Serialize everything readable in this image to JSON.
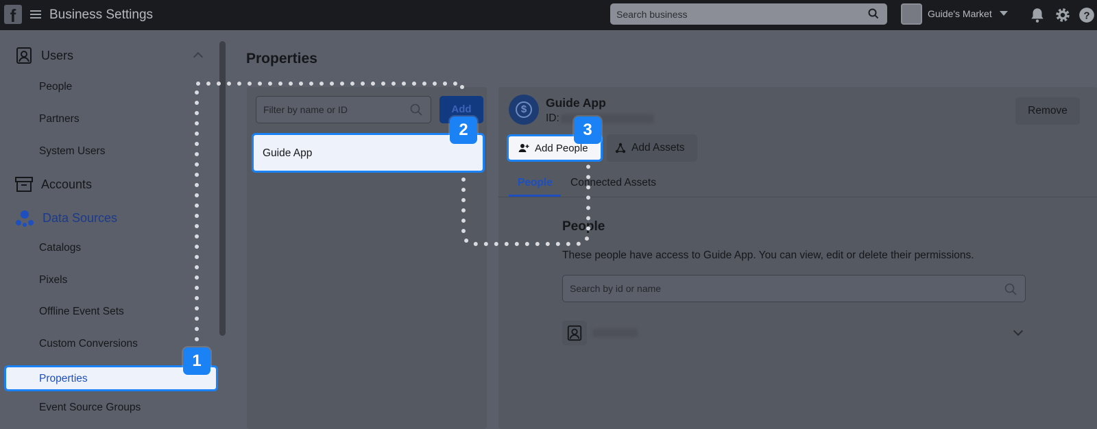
{
  "topbar": {
    "app_title": "Business Settings",
    "search_placeholder": "Search business",
    "business_name": "Guide's Market"
  },
  "sidebar": {
    "sections": {
      "users": "Users",
      "accounts": "Accounts",
      "data_sources": "Data Sources"
    },
    "user_items": [
      "People",
      "Partners",
      "System Users"
    ],
    "data_source_items": [
      "Catalogs",
      "Pixels",
      "Offline Event Sets",
      "Custom Conversions",
      "Properties",
      "Event Source Groups"
    ],
    "active_item": "Properties"
  },
  "main": {
    "title": "Properties",
    "filter_placeholder": "Filter by name or ID",
    "add_label": "Add",
    "list": [
      "Guide App"
    ]
  },
  "detail": {
    "app_name": "Guide App",
    "id_label": "ID:",
    "remove_label": "Remove",
    "add_people_label": "Add People",
    "add_assets_label": "Add Assets",
    "tabs": [
      "People",
      "Connected Assets"
    ],
    "people_heading": "People",
    "people_desc": "These people have access to Guide App. You can view, edit or delete their permissions.",
    "people_search_placeholder": "Search by id or name"
  },
  "steps": [
    "1",
    "2",
    "3"
  ],
  "colors": {
    "highlight": "#1a82f5",
    "active_text": "#1d4fbf",
    "topbar": "#1a1b1e"
  }
}
